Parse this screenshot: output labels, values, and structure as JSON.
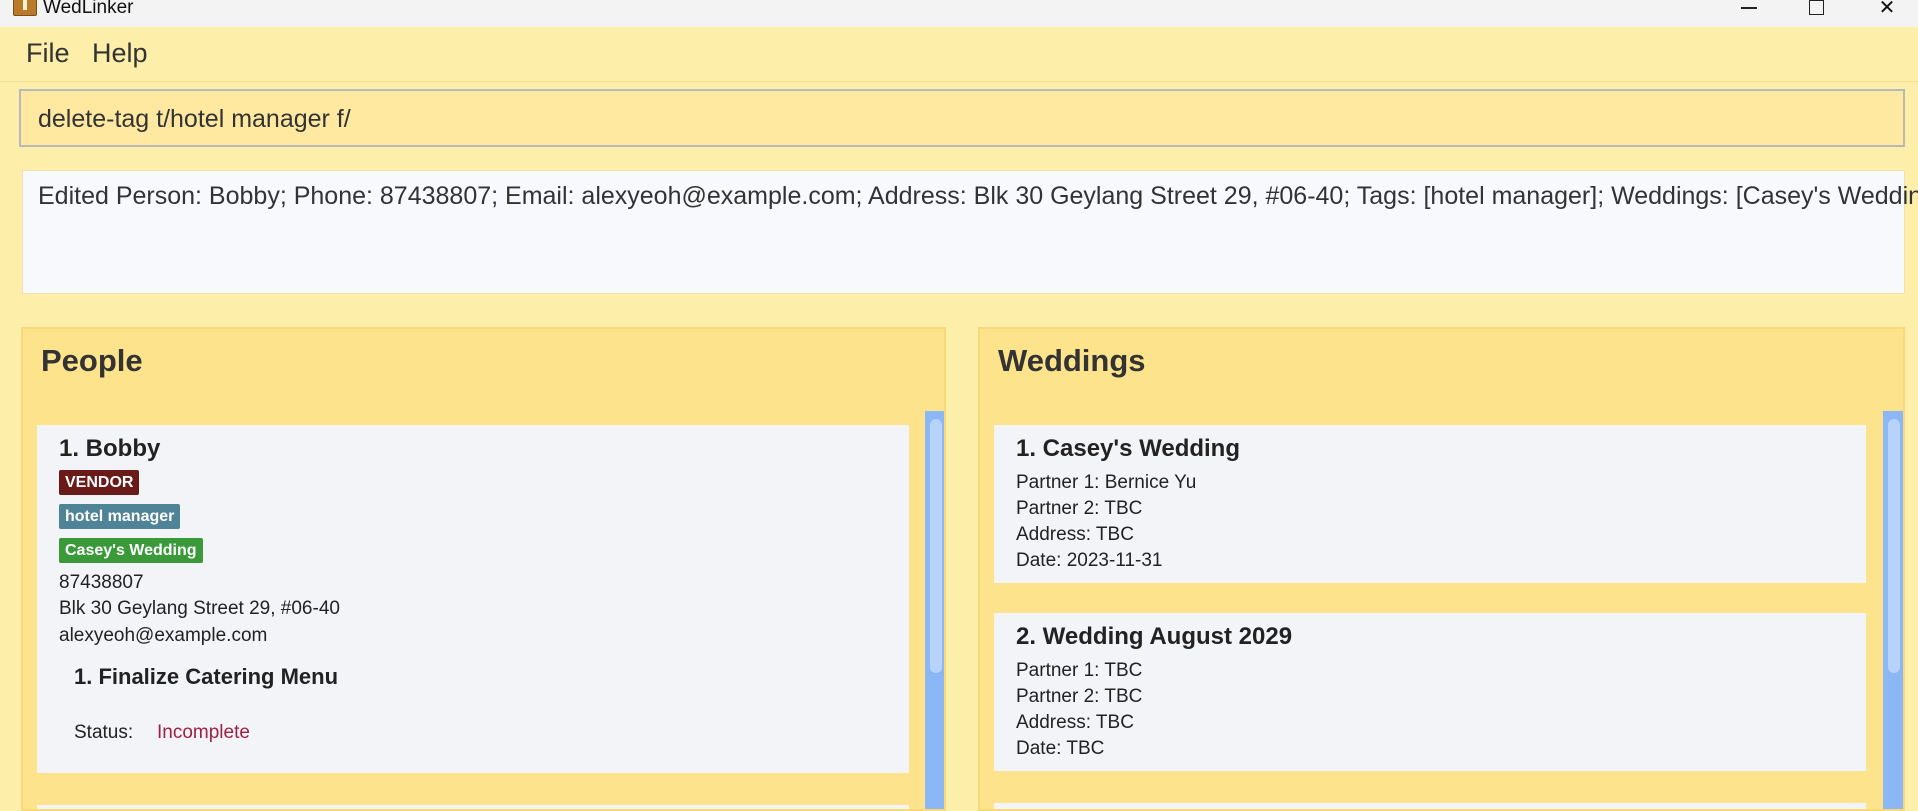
{
  "window": {
    "title": "WedLinker"
  },
  "menu": {
    "file": "File",
    "help": "Help"
  },
  "command": {
    "value": "delete-tag t/hotel manager f/"
  },
  "result": {
    "text": "Edited Person: Bobby; Phone: 87438807; Email: alexyeoh@example.com; Address: Blk 30 Geylang Street 29, #06-40; Tags: [hotel manager]; Weddings: [Casey's Wedding]"
  },
  "people_panel": {
    "title": "People",
    "persons": [
      {
        "name": "1. Bobby",
        "tags": [
          "VENDOR",
          "hotel manager",
          "Casey's Wedding"
        ],
        "phone": "87438807",
        "address": "Blk 30 Geylang Street 29, #06-40",
        "email": "alexyeoh@example.com",
        "task": "1.  Finalize Catering Menu",
        "status_label": "Status:",
        "status_value": "Incomplete"
      }
    ]
  },
  "weddings_panel": {
    "title": "Weddings",
    "weddings": [
      {
        "name": "1. Casey's Wedding",
        "partner1": "Partner 1: Bernice Yu",
        "partner2": "Partner 2: TBC",
        "address": "Address: TBC",
        "date": "Date: 2023-11-31"
      },
      {
        "name": "2. Wedding August 2029",
        "partner1": "Partner 1: TBC",
        "partner2": "Partner 2: TBC",
        "address": "Address: TBC",
        "date": "Date: TBC"
      }
    ]
  },
  "colors": {
    "background": "#fdeeaa",
    "panel": "#fde38b",
    "tag_vendor": "#6b1a1a",
    "tag_hotel": "#4f8397",
    "tag_wedding": "#3a9a3a",
    "status_incomplete": "#a02040",
    "scrollbar": "#8cb7f6"
  }
}
